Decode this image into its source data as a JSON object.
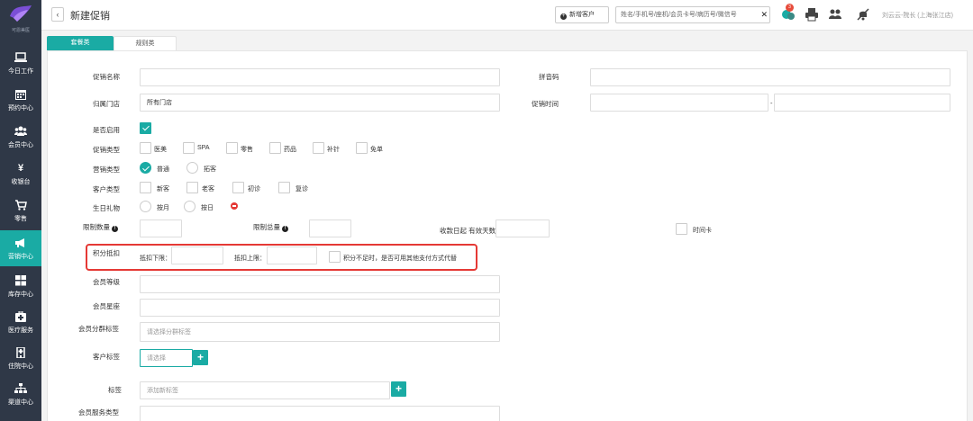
{
  "sidebar": {
    "logo_text": "可恩美医",
    "items": [
      {
        "label": "今日工作",
        "icon": "laptop-icon"
      },
      {
        "label": "预约中心",
        "icon": "calendar-icon"
      },
      {
        "label": "会员中心",
        "icon": "users-icon"
      },
      {
        "label": "收银台",
        "icon": "yen-icon"
      },
      {
        "label": "零售",
        "icon": "cart-icon"
      },
      {
        "label": "营销中心",
        "icon": "bullhorn-icon",
        "active": true
      },
      {
        "label": "库存中心",
        "icon": "grid-icon"
      },
      {
        "label": "医疗服务",
        "icon": "medkit-icon"
      },
      {
        "label": "住院中心",
        "icon": "hospital-icon"
      },
      {
        "label": "渠道中心",
        "icon": "sitemap-icon"
      }
    ]
  },
  "header": {
    "back_label": "‹",
    "title": "新建促销",
    "new_customer": "新增客户",
    "search_placeholder": "姓名/手机号/座机/会员卡号/病历号/微信号",
    "clear": "✕",
    "badge_count": "3",
    "user": "刘云云-院长 (上海张江店)"
  },
  "tabs": [
    "套餐类",
    "规则类"
  ],
  "form": {
    "promo_name": {
      "label": "促销名称",
      "value": ""
    },
    "pinyin": {
      "label": "拼音码",
      "value": ""
    },
    "store": {
      "label": "归属门店",
      "value": "所有门店"
    },
    "promo_time": {
      "label": "促销时间",
      "sep": "-"
    },
    "enabled": {
      "label": "是否启用",
      "checked": true
    },
    "promo_type": {
      "label": "促销类型",
      "options": [
        "医美",
        "SPA",
        "零售",
        "药品",
        "补针",
        "免单"
      ]
    },
    "marketing_type": {
      "label": "营销类型",
      "options": [
        "普通",
        "拓客"
      ],
      "selected": 0
    },
    "customer_type": {
      "label": "客户类型",
      "options": [
        "新客",
        "老客",
        "初诊",
        "复诊"
      ]
    },
    "birthday_gift": {
      "label": "生日礼物",
      "options": [
        "按月",
        "按日"
      ]
    },
    "limit_qty": {
      "label": "限制数量"
    },
    "limit_total": {
      "label": "限制总量"
    },
    "valid_days": {
      "label": "收款日起 有效天数"
    },
    "time_card": {
      "label": "时间卡"
    },
    "points": {
      "label": "积分抵扣",
      "lower": "抵扣下限：",
      "upper": "抵扣上限：",
      "insufficient": "积分不足时，是否可用其他支付方式代替"
    },
    "member_level": {
      "label": "会员等级"
    },
    "member_tier": {
      "label": "会员星座"
    },
    "member_group_tag": {
      "label": "会员分群标签",
      "placeholder": "请选择分群标签"
    },
    "customer_tag": {
      "label": "客户标签",
      "placeholder": "请选择"
    },
    "tag": {
      "label": "标签",
      "placeholder": "添加新标签"
    },
    "member_service_type": {
      "label": "会员服务类型"
    }
  },
  "colors": {
    "accent": "#1aaba4",
    "sidebar": "#2f3847",
    "highlight": "#e53935"
  }
}
